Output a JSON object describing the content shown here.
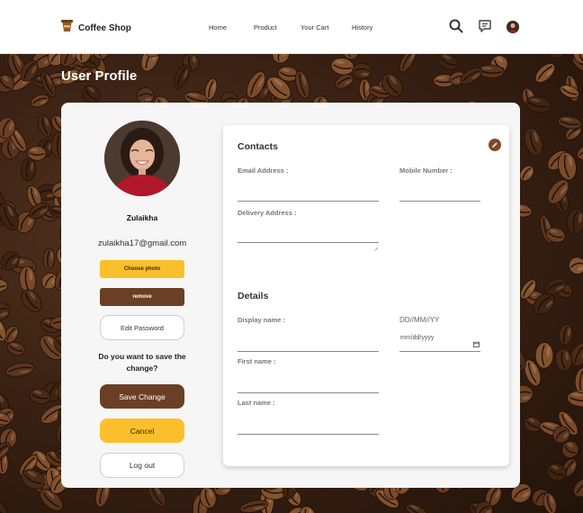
{
  "nav": {
    "brand": "Coffee Shop",
    "links": [
      "Home",
      "Product",
      "Your Cart",
      "History"
    ],
    "icons": [
      "coffee-cup-icon",
      "search-icon",
      "chat-icon",
      "avatar"
    ]
  },
  "page": {
    "title": "User Profile"
  },
  "profile": {
    "name": "Zulaikha",
    "email": "zulaikha17@gmail.com",
    "choose_photo": "Choose photo",
    "remove": "remove",
    "edit_password": "Edit Password",
    "question": "Do you want to save the change?",
    "save": "Save Change",
    "cancel": "Cancel",
    "logout": "Log out"
  },
  "contacts": {
    "heading": "Contacts",
    "email_label": "Email Address :",
    "mobile_label": "Mobile Number :",
    "address_label": "Delivery Address :"
  },
  "details": {
    "heading": "Details",
    "display_name_label": "Display name :",
    "dob_label": "DD//MM//YY",
    "dob_placeholder": "mm/dd/yyyy",
    "first_name_label": "First name :",
    "last_name_label": "Last name :"
  },
  "colors": {
    "accent_yellow": "#fbbf2c",
    "accent_brown": "#6a3f24",
    "card_bg": "#f6f6f6"
  }
}
